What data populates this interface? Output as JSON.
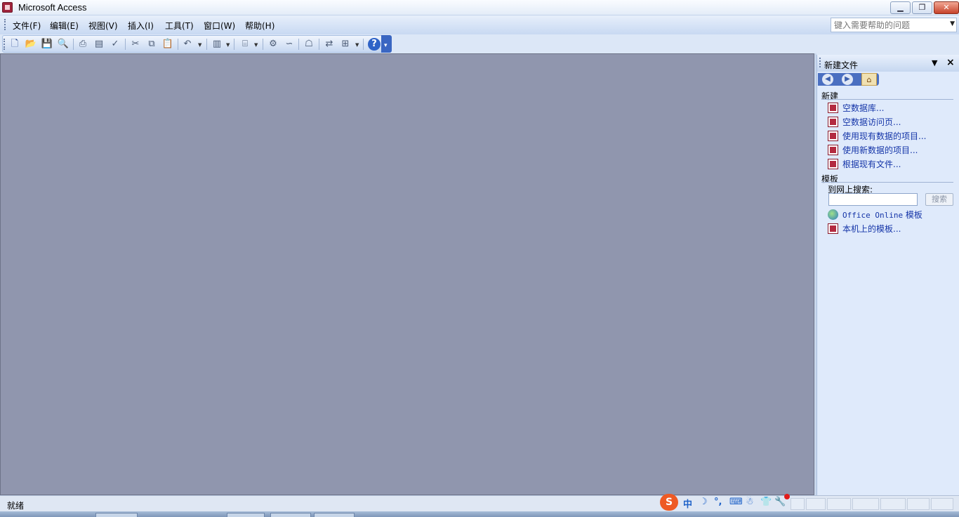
{
  "window": {
    "title": "Microsoft Access",
    "controls": [
      "minimize-icon",
      "restore-icon",
      "close-icon"
    ]
  },
  "menubar": {
    "items": [
      {
        "label": "文件(F)"
      },
      {
        "label": "编辑(E)"
      },
      {
        "label": "视图(V)"
      },
      {
        "label": "插入(I)"
      },
      {
        "label": "工具(T)"
      },
      {
        "label": "窗口(W)"
      },
      {
        "label": "帮助(H)"
      }
    ],
    "help_placeholder": "键入需要帮助的问题"
  },
  "toolbar": {
    "buttons": [
      "new-icon",
      "open-icon",
      "save-icon",
      "file-search-icon",
      "print-icon",
      "print-preview-icon",
      "spelling-icon",
      "cut-icon",
      "copy-icon",
      "paste-icon",
      "undo-icon",
      "office-links-icon",
      "analyze-icon",
      "code-icon",
      "script-icon",
      "properties-icon",
      "relationships-icon",
      "new-object-icon",
      "help-icon"
    ]
  },
  "taskpane": {
    "title": "新建文件",
    "section_new": "新建",
    "new_items": [
      {
        "label": "空数据库..."
      },
      {
        "label": "空数据访问页..."
      },
      {
        "label": "使用现有数据的项目..."
      },
      {
        "label": "使用新数据的项目..."
      },
      {
        "label": "根据现有文件..."
      }
    ],
    "section_templates": "模板",
    "search_label": "到网上搜索:",
    "search_value": "",
    "search_button": "搜索",
    "template_items": [
      {
        "label_mono": "Office Online",
        "label": " 模板"
      },
      {
        "label": "本机上的模板..."
      }
    ]
  },
  "statusbar": {
    "text": "就绪"
  },
  "ime": {
    "logo": "S",
    "items": [
      "中",
      "☽",
      "°,",
      "⌨",
      "☃",
      "👕",
      "🔧"
    ]
  },
  "colors": {
    "workspace": "#9096ae",
    "taskpane": "#dfeafb",
    "link": "#1535a8",
    "nav_bar": "#4a6fc1"
  }
}
